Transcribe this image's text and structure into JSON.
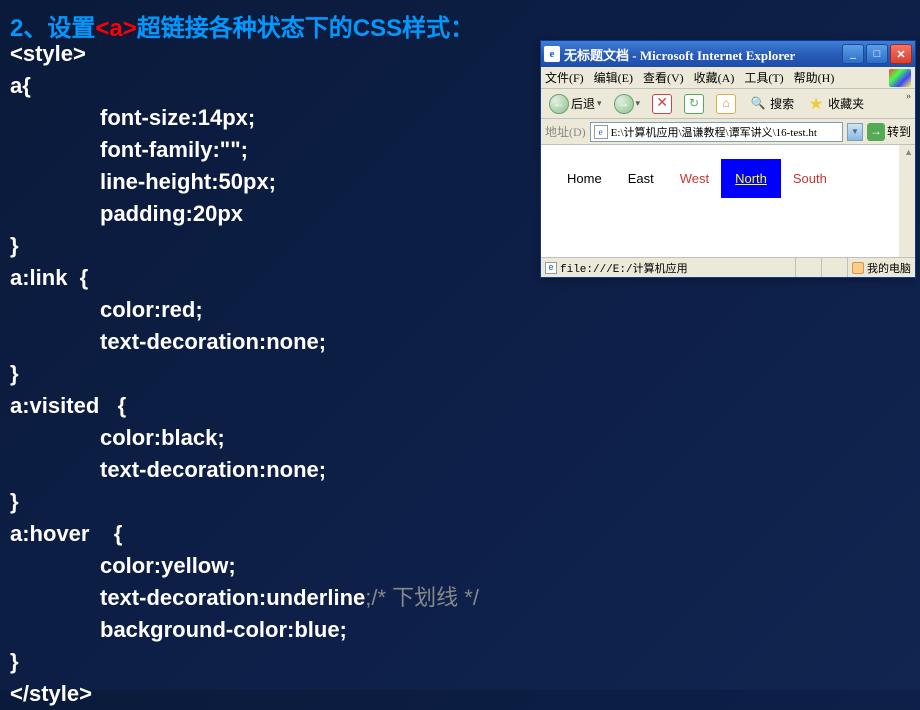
{
  "heading": {
    "prefix": "2、设置",
    "tag": "<a>",
    "suffix": "超链接各种状态下的CSS样式："
  },
  "code": {
    "l1": "<style>",
    "l2": "a{",
    "l3": "font-size:14px;",
    "l4": "font-family:\"\";",
    "l5": "line-height:50px;",
    "l6": "padding:20px",
    "l7": "}",
    "l8": "a:link  {",
    "l9": "color:red;",
    "l10": "text-decoration:none;",
    "l11": "}",
    "l12": "a:visited   {",
    "l13": "color:black;",
    "l14": "text-decoration:none;",
    "l15": "}",
    "l16": "a:hover    {",
    "l17": "color:yellow;",
    "l18": "text-decoration:underline",
    "l18c": ";/* 下划线 */",
    "l19": "background-color:blue;",
    "l20": "}",
    "l21": "</style>"
  },
  "browser": {
    "title": "无标题文档 - Microsoft Internet Explorer",
    "menu": {
      "file": "文件(F)",
      "edit": "编辑(E)",
      "view": "查看(V)",
      "fav": "收藏(A)",
      "tools": "工具(T)",
      "help": "帮助(H)"
    },
    "toolbar": {
      "back": "后退",
      "search": "搜索",
      "favorites": "收藏夹"
    },
    "address_label": "地址(D)",
    "address_value": "E:\\计算机应用\\温谦教程\\谭军讲义\\16-test.ht",
    "go": "转到",
    "nav": {
      "home": "Home",
      "east": "East",
      "west": "West",
      "north": "North",
      "south": "South"
    },
    "status_path": "file:///E:/计算机应用",
    "status_zone": "我的电脑"
  }
}
